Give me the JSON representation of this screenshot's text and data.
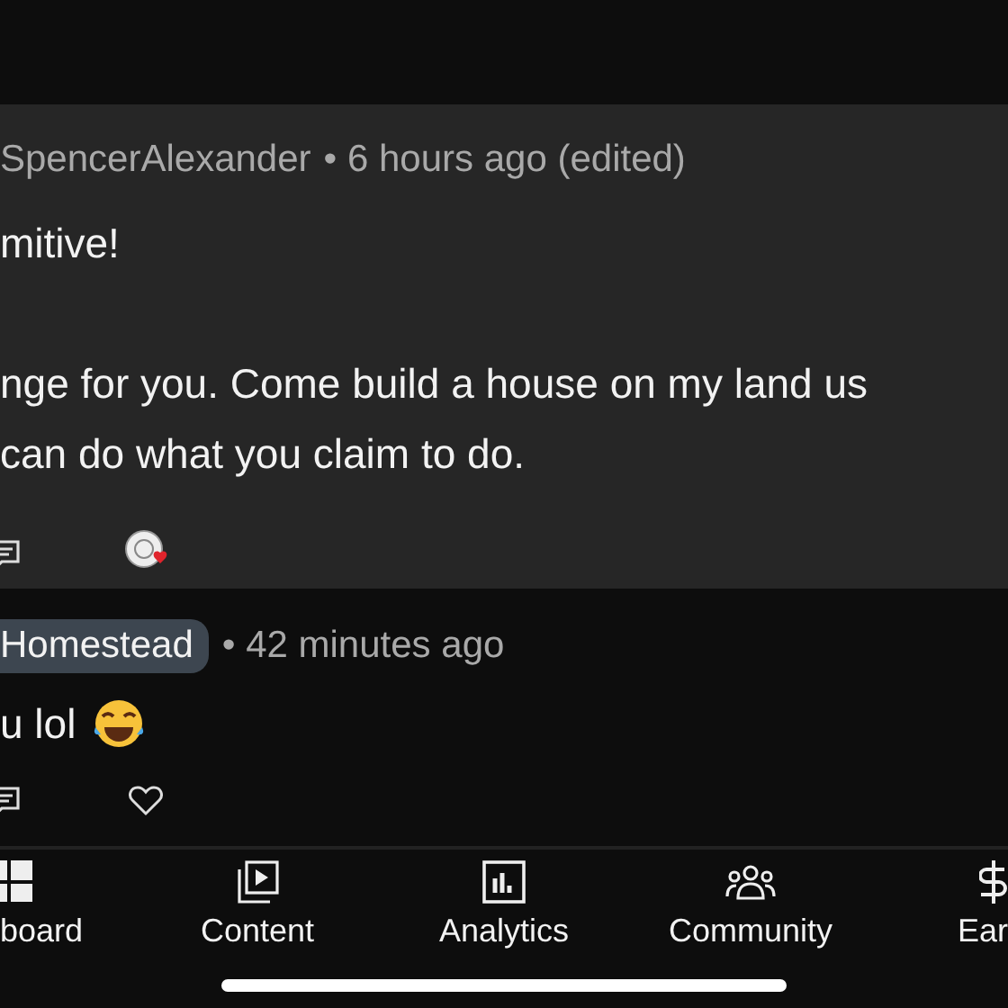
{
  "comment": {
    "author": "SpencerAlexander",
    "meta": "• 6 hours ago (edited)",
    "paragraphs": [
      "mitive!",
      "nge for you. Come build a house on my land us\ncan do what you claim to do."
    ]
  },
  "reply": {
    "author": "Homestead",
    "meta": "• 42 minutes ago",
    "text": "u lol"
  },
  "nav": [
    {
      "label": "board",
      "kind": "dashboard"
    },
    {
      "label": "Content",
      "kind": "content"
    },
    {
      "label": "Analytics",
      "kind": "analytics"
    },
    {
      "label": "Community",
      "kind": "community"
    },
    {
      "label": "Ear",
      "kind": "earn"
    }
  ]
}
